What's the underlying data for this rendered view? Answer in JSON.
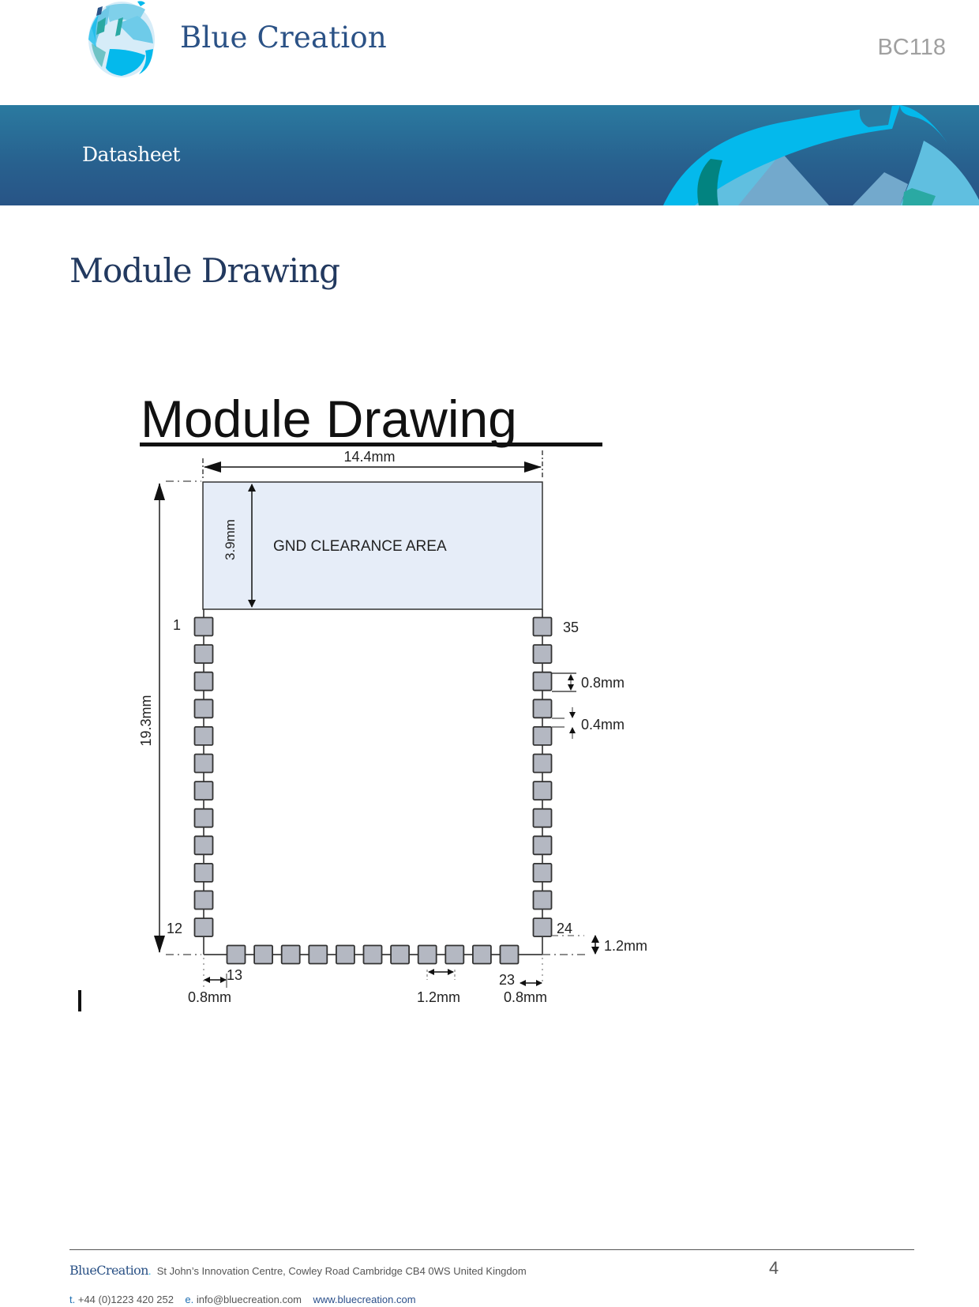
{
  "header": {
    "logo_text": "Blue Creation",
    "doc_code": "BC118",
    "banner_label": "Datasheet"
  },
  "page": {
    "title": "Module Drawing"
  },
  "drawing": {
    "title": "Module Drawing",
    "width_label": "14.4mm",
    "height_label": "19.3mm",
    "gnd_height_label": "3.9mm",
    "gnd_area_label": "GND CLEARANCE AREA",
    "pad_length_label": "0.8mm",
    "pad_gap_label": "0.4mm",
    "bottom_offset_label": "1.2mm",
    "left_edge_label": "0.8mm",
    "pitch_label": "1.2mm",
    "right_edge_label": "0.8mm",
    "pins": {
      "left": {
        "first": "1",
        "last": "12",
        "count": 12
      },
      "bottom": {
        "first": "13",
        "last": "23",
        "count": 11
      },
      "right": {
        "first": "24",
        "last": "35",
        "count": 12
      }
    },
    "colors": {
      "gnd_area_fill": "#e6edf8",
      "pad_fill": "#b4b8c2",
      "pad_stroke": "#333333"
    }
  },
  "footer": {
    "brand": "BlueCreation",
    "brand_dot": ".",
    "address": "St John’s Innovation Centre,  Cowley Road  Cambridge  CB4 0WS  United Kingdom",
    "phone_key": "t.",
    "phone": "+44 (0)1223 420 252",
    "email_key": "e.",
    "email": "info@bluecreation.com",
    "website": "www.bluecreation.com",
    "page_number": "4"
  }
}
